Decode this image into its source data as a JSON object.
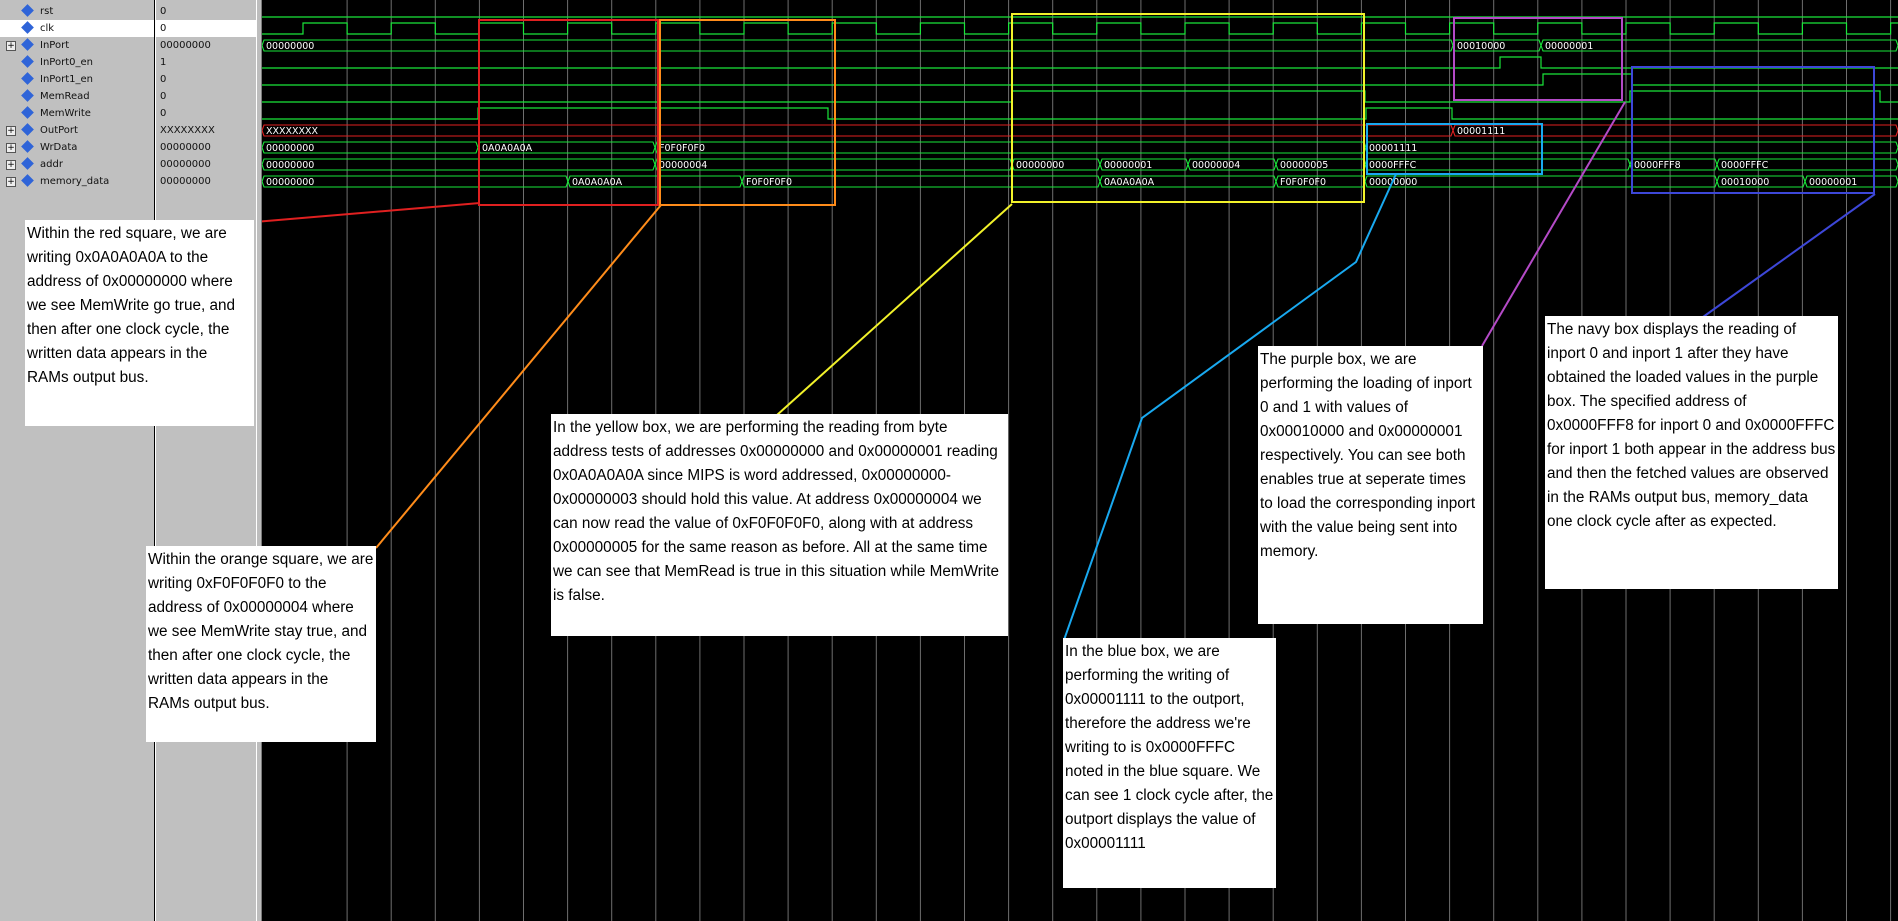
{
  "signals": [
    {
      "name": "rst",
      "value": "0",
      "expandable": false
    },
    {
      "name": "clk",
      "value": "0",
      "expandable": false
    },
    {
      "name": "InPort",
      "value": "00000000",
      "expandable": true
    },
    {
      "name": "InPort0_en",
      "value": "1",
      "expandable": false
    },
    {
      "name": "InPort1_en",
      "value": "0",
      "expandable": false
    },
    {
      "name": "MemRead",
      "value": "0",
      "expandable": false
    },
    {
      "name": "MemWrite",
      "value": "0",
      "expandable": false
    },
    {
      "name": "OutPort",
      "value": "XXXXXXXX",
      "expandable": true
    },
    {
      "name": "WrData",
      "value": "00000000",
      "expandable": true
    },
    {
      "name": "addr",
      "value": "00000000",
      "expandable": true
    },
    {
      "name": "memory_data",
      "value": "00000000",
      "expandable": true
    }
  ],
  "bus_labels": {
    "inport": [
      "00000000",
      "00010000",
      "00000001"
    ],
    "outport": [
      "XXXXXXXX",
      "00001111"
    ],
    "wrdata": [
      "00000000",
      "0A0A0A0A",
      "F0F0F0F0",
      "00001111"
    ],
    "addr": [
      "00000000",
      "00000004",
      "00000000",
      "00000001",
      "00000004",
      "00000005",
      "0000FFFC",
      "0000FFF8",
      "0000FFFC"
    ],
    "memory_data": [
      "00000000",
      "0A0A0A0A",
      "F0F0F0F0",
      "0A0A0A0A",
      "F0F0F0F0",
      "00000000",
      "00010000",
      "00000001"
    ]
  },
  "box_colors": {
    "red": "#e02020",
    "orange": "#ff8c1a",
    "yellow": "#f2f22a",
    "blue": "#19a9f0",
    "purple": "#b44ac7",
    "navy": "#3d47d8"
  },
  "annotations": {
    "red": "Within the red square, we are writing 0x0A0A0A0A to the address of 0x00000000 where we see MemWrite go true, and then after one clock cycle, the written data appears in the RAMs output bus.",
    "orange": "Within the orange square, we are writing 0xF0F0F0F0 to the address of 0x00000004 where we see MemWrite stay true, and then after one clock cycle, the written data appears in the RAMs output bus.",
    "yellow": "In the yellow box, we are performing the reading from byte address tests of addresses 0x00000000 and 0x00000001 reading 0x0A0A0A0A since MIPS is word addressed, 0x00000000-0x00000003 should hold this value. At address 0x00000004 we can now read the value of 0xF0F0F0F0, along with at address 0x00000005 for the same reason as before. All at the same time we can see that MemRead is true in this situation while MemWrite is false.",
    "blue": "In the blue box, we are performing the writing of 0x00001111 to the outport, therefore the address we're writing to is 0x0000FFFC noted in the blue square. We can see 1 clock cycle after, the outport displays the value of 0x00001111",
    "purple": "The purple box, we are performing the loading of inport 0 and 1 with values of 0x00010000 and 0x00000001 respectively. You can see both enables true at seperate times to load the corresponding inport with the value being sent into memory.",
    "navy": "The navy box displays the reading of inport 0 and inport 1 after they have obtained the loaded values in the purple box. The specified address of 0x0000FFF8 for inport 0 and 0x0000FFFC for inport 1 both appear in the address bus and then the fetched values are observed in the RAMs output bus, memory_data one clock cycle after as expected."
  }
}
